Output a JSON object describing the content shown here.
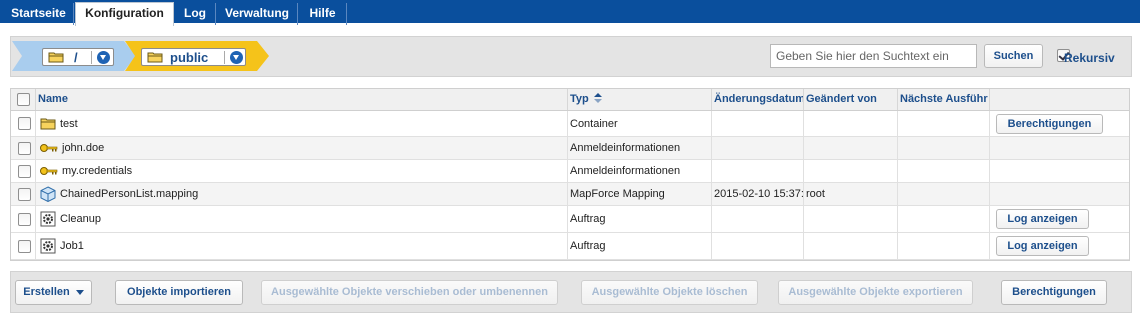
{
  "nav": {
    "tabs": [
      {
        "label": "Startseite",
        "active": false
      },
      {
        "label": "Konfiguration",
        "active": true
      },
      {
        "label": "Log",
        "active": false
      },
      {
        "label": "Verwaltung",
        "active": false
      },
      {
        "label": "Hilfe",
        "active": false
      }
    ]
  },
  "breadcrumb": [
    {
      "label": "/",
      "color": "#a9cdee"
    },
    {
      "label": "public",
      "color": "#f5c31a"
    }
  ],
  "search": {
    "placeholder": "Geben Sie hier den Suchtext ein",
    "button": "Suchen",
    "recursive_label": "Rekursiv",
    "recursive_checked": true
  },
  "table": {
    "headers": {
      "name": "Name",
      "type": "Typ",
      "modified": "Änderungsdatum",
      "modified_by": "Geändert von",
      "next_run": "Nächste Ausführ"
    },
    "rows": [
      {
        "icon": "folder-icon",
        "name": "test",
        "type": "Container",
        "modified": "",
        "modified_by": "",
        "next_run": "",
        "action": "Berechtigungen"
      },
      {
        "icon": "key-icon",
        "name": "john.doe",
        "type": "Anmeldeinformationen",
        "modified": "",
        "modified_by": "",
        "next_run": "",
        "action": ""
      },
      {
        "icon": "key-icon",
        "name": "my.credentials",
        "type": "Anmeldeinformationen",
        "modified": "",
        "modified_by": "",
        "next_run": "",
        "action": ""
      },
      {
        "icon": "mapping-icon",
        "name": "ChainedPersonList.mapping",
        "type": "MapForce Mapping",
        "modified": "2015-02-10 15:37:",
        "modified_by": "root",
        "next_run": "",
        "action": ""
      },
      {
        "icon": "gear-icon",
        "name": "Cleanup",
        "type": "Auftrag",
        "modified": "",
        "modified_by": "",
        "next_run": "",
        "action": "Log anzeigen"
      },
      {
        "icon": "gear-icon",
        "name": "Job1",
        "type": "Auftrag",
        "modified": "",
        "modified_by": "",
        "next_run": "",
        "action": "Log anzeigen"
      }
    ]
  },
  "footer": {
    "create": "Erstellen",
    "import": "Objekte importieren",
    "move": "Ausgewählte Objekte verschieben oder umbenennen",
    "delete": "Ausgewählte Objekte löschen",
    "export": "Ausgewählte Objekte exportieren",
    "permissions": "Berechtigungen"
  }
}
